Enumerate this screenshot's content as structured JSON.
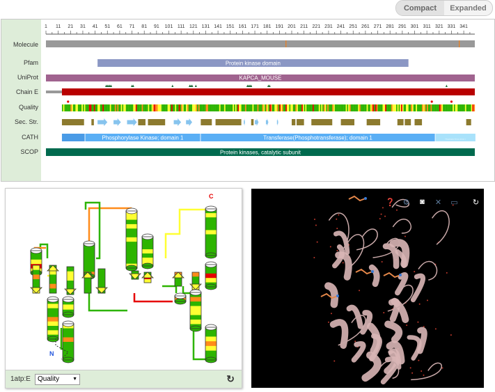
{
  "view_toggle": {
    "compact": "Compact",
    "expanded": "Expanded",
    "selected": "Compact"
  },
  "tracks": {
    "range": [
      1,
      350
    ],
    "ruler_ticks": [
      1,
      11,
      21,
      31,
      41,
      51,
      61,
      71,
      81,
      91,
      101,
      111,
      121,
      131,
      141,
      151,
      161,
      171,
      181,
      191,
      201,
      211,
      221,
      231,
      241,
      251,
      261,
      271,
      281,
      291,
      301,
      311,
      321,
      331,
      341
    ],
    "labels": {
      "molecule": "Molecule",
      "pfam": "Pfam",
      "uniprot": "UniProt",
      "chain": "Chain E",
      "quality": "Quality",
      "secstr": "Sec. Str.",
      "cath": "CATH",
      "scop": "SCOP"
    },
    "molecule": {
      "start": 1,
      "end": 350,
      "color": "#999999",
      "marks": [
        196,
        337
      ],
      "mark_color": "#f07f1a"
    },
    "pfam": {
      "start": 43,
      "end": 296,
      "label": "Protein kinase domain",
      "color": "#8b97c4"
    },
    "uniprot": {
      "start": 1,
      "end": 350,
      "label": "KAPCA_MOUSE",
      "color": "#a0638f"
    },
    "chain": {
      "unobserved": [
        1,
        14
      ],
      "observed": [
        14,
        350
      ],
      "color": "#b80000",
      "ligand_sites": [
        50,
        51,
        52,
        53,
        54,
        71,
        72,
        104,
        118,
        119,
        120,
        123,
        165,
        166,
        167,
        168,
        182,
        183,
        327
      ],
      "site_color": "#1f6b3a"
    },
    "quality": {
      "start": 14,
      "end": 350,
      "outliers": [
        19,
        315,
        331
      ],
      "colors": [
        "#2db400",
        "#ffff33",
        "#ff8c1a",
        "#e60000"
      ]
    },
    "secstr": {
      "helix_color": "#8c7a2e",
      "strand_color": "#87c4ee",
      "elements": [
        {
          "type": "helix",
          "start": 14,
          "end": 32
        },
        {
          "type": "helix",
          "start": 38,
          "end": 40
        },
        {
          "type": "strand",
          "start": 43,
          "end": 51
        },
        {
          "type": "strand",
          "start": 56,
          "end": 62
        },
        {
          "type": "strand",
          "start": 67,
          "end": 75
        },
        {
          "type": "helix",
          "start": 76,
          "end": 82
        },
        {
          "type": "helix",
          "start": 84,
          "end": 98
        },
        {
          "type": "strand",
          "start": 105,
          "end": 111
        },
        {
          "type": "strand",
          "start": 115,
          "end": 120
        },
        {
          "type": "helix",
          "start": 127,
          "end": 136
        },
        {
          "type": "helix",
          "start": 139,
          "end": 160
        },
        {
          "type": "strand",
          "start": 162,
          "end": 163
        },
        {
          "type": "helix",
          "start": 168,
          "end": 170
        },
        {
          "type": "strand",
          "start": 171,
          "end": 174
        },
        {
          "type": "strand",
          "start": 180,
          "end": 182
        },
        {
          "type": "strand",
          "start": 189,
          "end": 190
        },
        {
          "type": "helix",
          "start": 201,
          "end": 204
        },
        {
          "type": "helix",
          "start": 205,
          "end": 211
        },
        {
          "type": "helix",
          "start": 217,
          "end": 234
        },
        {
          "type": "helix",
          "start": 241,
          "end": 252
        },
        {
          "type": "helix",
          "start": 262,
          "end": 273
        },
        {
          "type": "helix",
          "start": 287,
          "end": 292
        },
        {
          "type": "helix",
          "start": 293,
          "end": 298
        },
        {
          "type": "helix",
          "start": 301,
          "end": 307
        },
        {
          "type": "helix",
          "start": 343,
          "end": 347
        }
      ]
    },
    "cath": [
      {
        "start": 14,
        "end": 32,
        "label": "",
        "color": "#4a9be6"
      },
      {
        "start": 33,
        "end": 126,
        "label": "Phosphorylase Kinase; domain 1",
        "color": "#5aaff5"
      },
      {
        "start": 127,
        "end": 317,
        "label": "Transferase(Phosphotransferase); domain 1",
        "color": "#5aaff5"
      },
      {
        "start": 318,
        "end": 350,
        "label": "Phosphorylase Kinase; domain 1",
        "color": "#a9e2fb"
      }
    ],
    "scop": {
      "start": 1,
      "end": 350,
      "label": "Protein kinases, catalytic subunit",
      "color": "#006a4e"
    }
  },
  "topology": {
    "chain_label": "1atp:E",
    "color_by": "Quality",
    "n_term": "N",
    "c_term": "C"
  },
  "viewer": {
    "icons": [
      "help-icon",
      "gear-icon",
      "camera-icon",
      "tools-icon",
      "fullscreen-icon",
      "reset-icon"
    ]
  }
}
